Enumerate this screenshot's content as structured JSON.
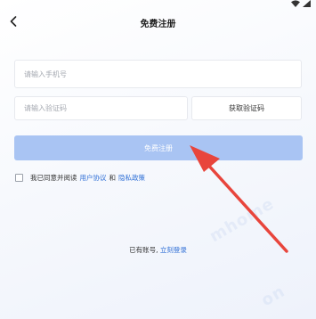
{
  "nav": {
    "title": "免费注册"
  },
  "form": {
    "phone_placeholder": "请输入手机号",
    "code_placeholder": "请输入验证码",
    "get_code_label": "获取验证码",
    "register_label": "免费注册"
  },
  "agreement": {
    "prefix": "我已同意并阅读",
    "user_agreement": "用户协议",
    "conjunction": "和",
    "privacy_policy": "隐私政策"
  },
  "login": {
    "prompt": "已有账号,",
    "link": "立刻登录"
  },
  "watermark": {
    "text": "mhome",
    "text2": "on"
  },
  "colors": {
    "accent": "#2f6fd6",
    "register_button": "#a9c4f3",
    "arrow": "#e8453c"
  },
  "icons": {
    "back": "chevron-left-icon",
    "wifi": "wifi-icon",
    "signal": "signal-icon"
  }
}
